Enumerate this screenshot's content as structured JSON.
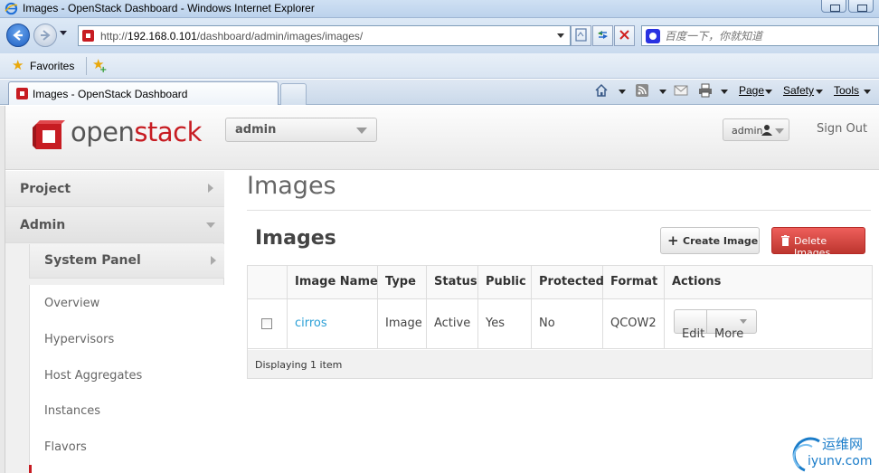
{
  "browser": {
    "window_title": "Images - OpenStack Dashboard - Windows Internet Explorer",
    "url_prefix": "http://",
    "url_host": "192.168.0.101",
    "url_path": "/dashboard/admin/images/images/",
    "search_placeholder": "百度一下，你就知道",
    "favorites_label": "Favorites",
    "tab_title": "Images - OpenStack Dashboard",
    "commands": {
      "page": "Page",
      "safety": "Safety",
      "tools": "Tools"
    }
  },
  "header": {
    "logo_open": "open",
    "logo_stack": "stack",
    "project": "admin",
    "user": "admin",
    "sign_out": "Sign Out"
  },
  "sidebar": {
    "project": "Project",
    "admin": "Admin",
    "system_panel": "System Panel",
    "items": [
      "Overview",
      "Hypervisors",
      "Host Aggregates",
      "Instances",
      "Flavors"
    ]
  },
  "main": {
    "page_title": "Images",
    "table_title": "Images",
    "create_label": "Create Image",
    "delete_label": "Delete Images",
    "columns": [
      "Image Name",
      "Type",
      "Status",
      "Public",
      "Protected",
      "Format",
      "Actions"
    ],
    "rows": [
      {
        "name": "cirros",
        "type": "Image",
        "status": "Active",
        "public": "Yes",
        "protected": "No",
        "format": "QCOW2"
      }
    ],
    "edit_label": "Edit",
    "more_label": "More",
    "footer": "Displaying 1 item"
  },
  "watermark": {
    "cn": "运维网",
    "en": "iyunv.com"
  },
  "colors": {
    "brand_red": "#c71c22",
    "link_blue": "#2a9fd6",
    "danger": "#da4f49"
  }
}
